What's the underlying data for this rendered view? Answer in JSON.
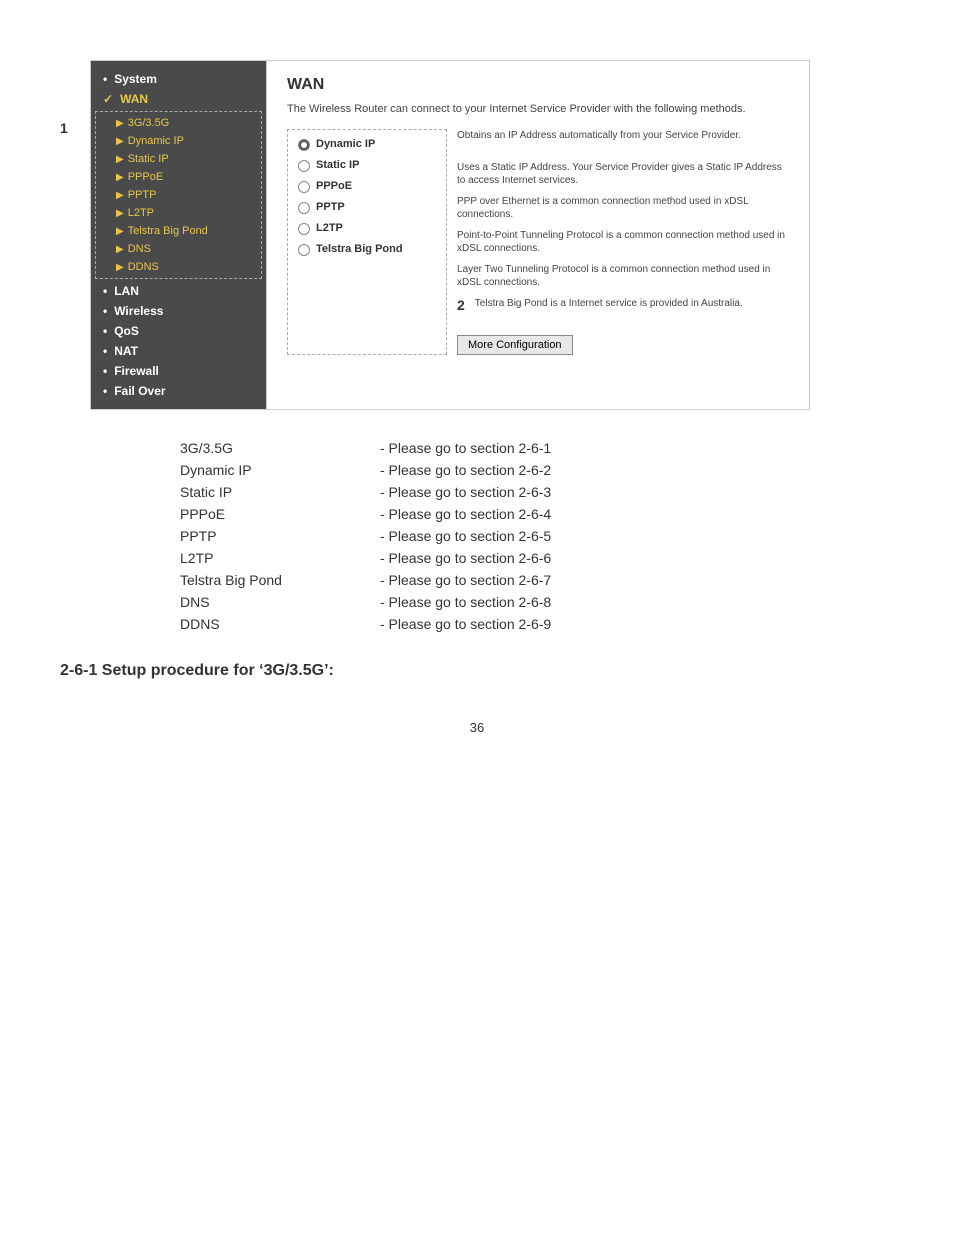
{
  "page": {
    "number": "36"
  },
  "router_ui": {
    "step_number": "1",
    "sidebar": {
      "items": [
        {
          "id": "system",
          "label": "System",
          "type": "top-level"
        },
        {
          "id": "wan",
          "label": "WAN",
          "type": "active-wan"
        },
        {
          "id": "3g35g",
          "label": "3G/3.5G",
          "type": "sub"
        },
        {
          "id": "dynamic-ip",
          "label": "Dynamic IP",
          "type": "sub"
        },
        {
          "id": "static-ip",
          "label": "Static IP",
          "type": "sub"
        },
        {
          "id": "pppoe",
          "label": "PPPoE",
          "type": "sub"
        },
        {
          "id": "pptp",
          "label": "PPTP",
          "type": "sub"
        },
        {
          "id": "l2tp",
          "label": "L2TP",
          "type": "sub"
        },
        {
          "id": "telstra",
          "label": "Telstra Big Pond",
          "type": "sub"
        },
        {
          "id": "dns",
          "label": "DNS",
          "type": "sub"
        },
        {
          "id": "ddns",
          "label": "DDNS",
          "type": "sub"
        },
        {
          "id": "lan",
          "label": "LAN",
          "type": "top-level"
        },
        {
          "id": "wireless",
          "label": "Wireless",
          "type": "top-level"
        },
        {
          "id": "qos",
          "label": "QoS",
          "type": "top-level"
        },
        {
          "id": "nat",
          "label": "NAT",
          "type": "top-level"
        },
        {
          "id": "firewall",
          "label": "Firewall",
          "type": "top-level"
        },
        {
          "id": "failover",
          "label": "Fail Over",
          "type": "top-level"
        }
      ]
    },
    "main": {
      "title": "WAN",
      "description": "The Wireless Router can connect to your Internet Service Provider with the following methods.",
      "options": [
        {
          "id": "dynamic-ip",
          "label": "Dynamic IP",
          "selected": true,
          "description": "Obtains an IP Address automatically from your Service Provider."
        },
        {
          "id": "static-ip",
          "label": "Static IP",
          "selected": false,
          "description": "Uses a Static IP Address. Your Service Provider gives a Static IP Address to access Internet services."
        },
        {
          "id": "pppoe",
          "label": "PPPoE",
          "selected": false,
          "description": "PPP over Ethernet is a common connection method used in xDSL connections."
        },
        {
          "id": "pptp",
          "label": "PPTP",
          "selected": false,
          "description": "Point-to-Point Tunneling Protocol is a common connection method used in xDSL connections."
        },
        {
          "id": "l2tp",
          "label": "L2TP",
          "selected": false,
          "description": "Layer Two Tunneling Protocol is a common connection method used in xDSL connections."
        },
        {
          "id": "telstra",
          "label": "Telstra Big Pond",
          "selected": false,
          "description": "Telstra Big Pond is a Internet service is provided in Australia."
        }
      ],
      "step2_marker": "2",
      "more_config_button": "More Configuration"
    }
  },
  "section_list": {
    "items": [
      {
        "label": "3G/3.5G",
        "ref": "- Please go to section 2-6-1"
      },
      {
        "label": "Dynamic IP",
        "ref": "- Please go to section 2-6-2"
      },
      {
        "label": "Static IP",
        "ref": "- Please go to section 2-6-3"
      },
      {
        "label": "PPPoE",
        "ref": "- Please go to section 2-6-4"
      },
      {
        "label": "PPTP",
        "ref": "- Please go to section 2-6-5"
      },
      {
        "label": "L2TP",
        "ref": "- Please go to section 2-6-6"
      },
      {
        "label": "Telstra Big Pond",
        "ref": "- Please go to section 2-6-7"
      },
      {
        "label": "DNS",
        "ref": "- Please go to section 2-6-8"
      },
      {
        "label": "DDNS",
        "ref": "- Please go to section 2-6-9"
      }
    ]
  },
  "setup_section": {
    "heading": "2-6-1 Setup procedure for ‘3G/3.5G’:"
  }
}
